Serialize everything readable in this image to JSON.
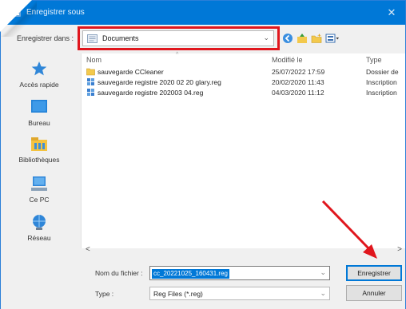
{
  "window": {
    "title": "Enregistrer sous",
    "close_glyph": "✕"
  },
  "toolbar": {
    "save_in_label": "Enregistrer dans :",
    "current_folder": "Documents",
    "dropdown_glyph": "⌄"
  },
  "nav": {
    "items": [
      {
        "label": "Accès rapide",
        "icon": "star-icon"
      },
      {
        "label": "Bureau",
        "icon": "desktop-icon"
      },
      {
        "label": "Bibliothèques",
        "icon": "libraries-icon"
      },
      {
        "label": "Ce PC",
        "icon": "computer-icon"
      },
      {
        "label": "Réseau",
        "icon": "network-icon"
      }
    ]
  },
  "files": {
    "headers": {
      "name": "Nom",
      "modified": "Modifié le",
      "type": "Type"
    },
    "sort_glyph": "^",
    "rows": [
      {
        "name": "sauvegarde CCleaner",
        "modified": "25/07/2022 17:59",
        "type": "Dossier de",
        "icon": "folder-icon"
      },
      {
        "name": "sauvegarde registre 2020 02 20 glary.reg",
        "modified": "20/02/2020 11:43",
        "type": "Inscription",
        "icon": "reg-file-icon"
      },
      {
        "name": "sauvegarde registre 202003 04.reg",
        "modified": "04/03/2020 11:12",
        "type": "Inscription",
        "icon": "reg-file-icon"
      }
    ]
  },
  "scroll": {
    "left_glyph": "<",
    "right_glyph": ">"
  },
  "form": {
    "filename_label": "Nom du fichier :",
    "filename_value": "cc_20221025_160431.reg",
    "type_label": "Type :",
    "type_value": "Reg Files (*.reg)",
    "dropdown_glyph": "⌄",
    "save_button": "Enregistrer",
    "cancel_button": "Annuler"
  },
  "colors": {
    "accent": "#0078d7",
    "highlight": "#e0161d"
  }
}
